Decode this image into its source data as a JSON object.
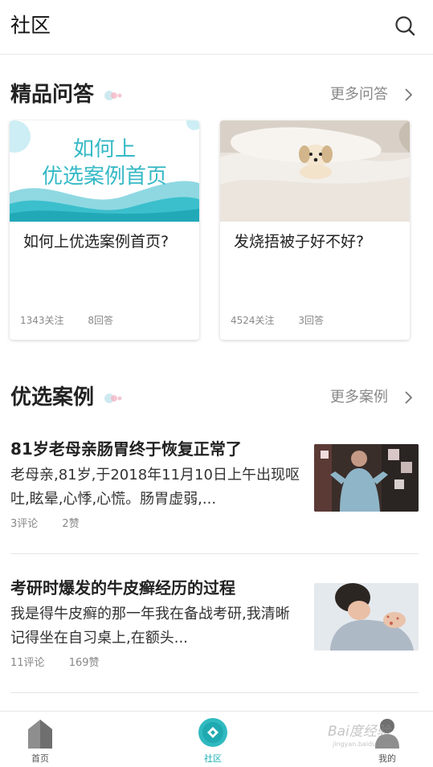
{
  "header": {
    "title": "社区",
    "search_icon": "search-icon"
  },
  "qa_section": {
    "title": "精品问答",
    "more_label": "更多问答",
    "cards": [
      {
        "image_text_line1": "如何上",
        "image_text_line2": "优选案例首页",
        "title": "如何上优选案例首页?",
        "follows": "1343关注",
        "answers": "8回答"
      },
      {
        "title": "发烧捂被子好不好?",
        "follows": "4524关注",
        "answers": "3回答"
      }
    ]
  },
  "cases_section": {
    "title": "优选案例",
    "more_label": "更多案例",
    "items": [
      {
        "title": "81岁老母亲肠胃终于恢复正常了",
        "desc": "老母亲,81岁,于2018年11月10日上午出现呕吐,眩晕,心悸,心慌。肠胃虚弱,...",
        "comments": "3评论",
        "likes": "2赞"
      },
      {
        "title": "考研时爆发的牛皮癣经历的过程",
        "desc": "我是得牛皮癣的那一年我在备战考研,我清晰记得坐在自习桌上,在额头...",
        "comments": "11评论",
        "likes": "169赞"
      }
    ]
  },
  "tabbar": {
    "tabs": [
      {
        "label": "首页",
        "icon": "home-icon"
      },
      {
        "label": "社区",
        "icon": "community-icon",
        "active": true
      },
      {
        "label": "我的",
        "icon": "profile-icon"
      }
    ]
  },
  "watermark": {
    "text": "Bai度经验",
    "sub": "jingyan.baidu.com"
  },
  "colors": {
    "accent": "#1fb2b6",
    "text": "#222222",
    "muted": "#888888"
  }
}
